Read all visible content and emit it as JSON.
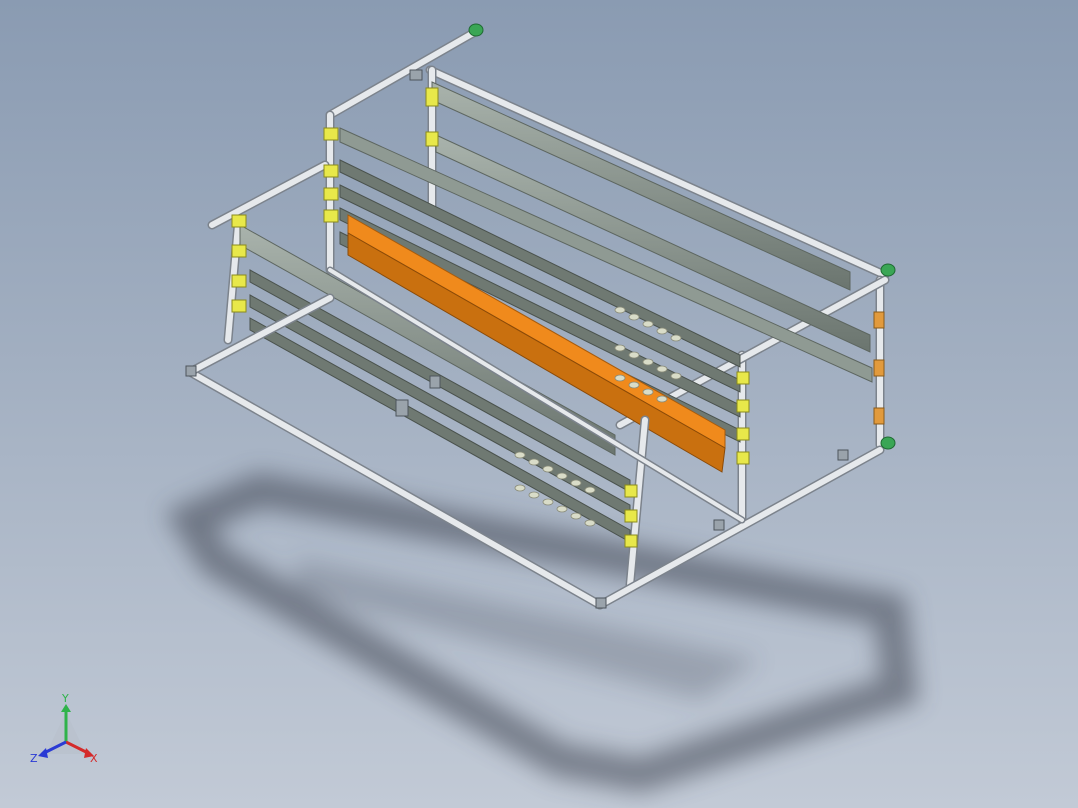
{
  "viewport": {
    "background_top": "#8a9bb2",
    "background_bottom": "#c2cad6"
  },
  "model": {
    "description_icon": "shelving-rack-assembly-icon",
    "colors": {
      "frame_tube": "#e6e9ec",
      "frame_edge": "#7c838c",
      "rail_gray": "#8f9a93",
      "rail_dark": "#5d6660",
      "clamp_yellow": "#e8e84a",
      "channel_orange": "#f08a1c",
      "cap_green": "#3aa655",
      "roller": "#d9dcc8",
      "shadow": "#3c4250"
    }
  },
  "triad": {
    "x_label": "X",
    "y_label": "Y",
    "z_label": "Z",
    "x_color": "#d42a2a",
    "y_color": "#2fb34a",
    "z_color": "#2a3ad4"
  }
}
